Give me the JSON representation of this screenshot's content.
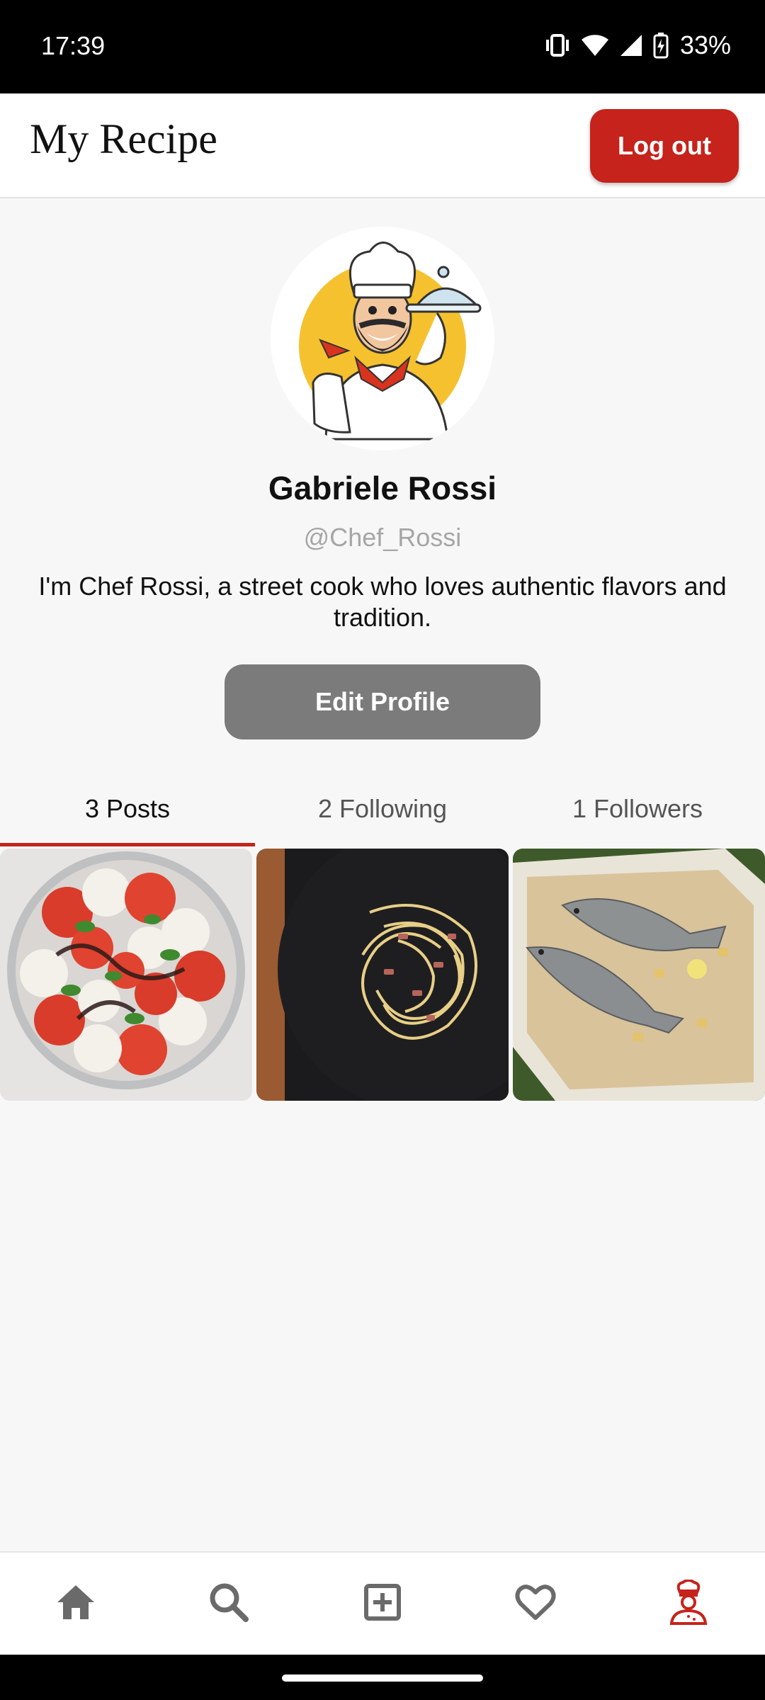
{
  "status_bar": {
    "time": "17:39",
    "battery": "33%",
    "icons": [
      "vibrate-icon",
      "wifi-icon",
      "cell-signal-icon",
      "battery-charging-icon"
    ]
  },
  "app_bar": {
    "title": "My Recipe",
    "logout_label": "Log out",
    "accent_color": "#c5231b"
  },
  "profile": {
    "avatar_icon": "chef-avatar",
    "name": "Gabriele Rossi",
    "handle": "@Chef_Rossi",
    "bio": "I'm Chef Rossi, a street cook who loves authentic flavors and tradition.",
    "edit_label": "Edit Profile"
  },
  "tabs": [
    {
      "label": "3 Posts",
      "active": true
    },
    {
      "label": "2 Following",
      "active": false
    },
    {
      "label": "1 Followers",
      "active": false
    }
  ],
  "posts": [
    {
      "icon": "caprese-salad-photo"
    },
    {
      "icon": "carbonara-pasta-photo"
    },
    {
      "icon": "baked-fish-photo"
    }
  ],
  "bottom_nav": [
    {
      "icon": "home-icon",
      "active": false
    },
    {
      "icon": "search-icon",
      "active": false
    },
    {
      "icon": "add-post-icon",
      "active": false
    },
    {
      "icon": "heart-icon",
      "active": false
    },
    {
      "icon": "chef-profile-icon",
      "active": true
    }
  ]
}
